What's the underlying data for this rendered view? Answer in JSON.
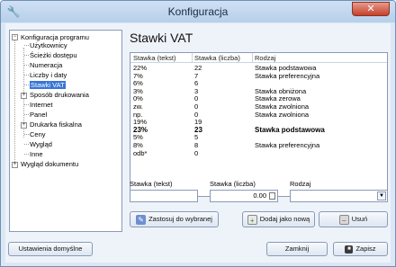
{
  "window": {
    "title": "Konfiguracja",
    "app_icon": "wrench-icon",
    "close": "✕"
  },
  "tree": {
    "root": "Konfiguracja programu",
    "children": [
      "Użytkownicy",
      "Ścieżki dostępu",
      "Numeracja",
      "Liczby i daty",
      "Stawki VAT",
      "Sposób drukowania",
      "Internet",
      "Panel",
      "Drukarka fiskalna",
      "Ceny",
      "Wygląd",
      "Inne"
    ],
    "selected": "Stawki VAT",
    "last": "Wygląd dokumentu"
  },
  "panel_title": "Stawki VAT",
  "table": {
    "headers": [
      "Stawka (tekst)",
      "Stawka (liczba)",
      "Rodzaj"
    ],
    "rows": [
      [
        "22%",
        "22",
        "Stawka podstawowa"
      ],
      [
        "7%",
        "7",
        "Stawka preferencyjna"
      ],
      [
        "6%",
        "6",
        ""
      ],
      [
        "3%",
        "3",
        "Stawka obniżona"
      ],
      [
        "0%",
        "0",
        "Stawka zerowa"
      ],
      [
        "zw.",
        "0",
        "Stawka zwolniona"
      ],
      [
        "np.",
        "0",
        "Stawka zwolniona"
      ],
      [
        "19%",
        "19",
        ""
      ],
      [
        "23%",
        "23",
        "Stawka podstawowa"
      ],
      [
        "5%",
        "5",
        ""
      ],
      [
        "8%",
        "8",
        "Stawka preferencyjna"
      ],
      [
        "odb*",
        "0",
        ""
      ]
    ],
    "bold_row": 8
  },
  "form": {
    "label_text": "Stawka (tekst)",
    "label_num": "Stawka (liczba)",
    "label_kind": "Rodzaj",
    "num_value": "0.00"
  },
  "buttons": {
    "apply": "Zastosuj do wybranej",
    "add": "Dodaj jako nową",
    "delete": "Usuń",
    "defaults": "Ustawienia domyślne",
    "close": "Zamknij",
    "save": "Zapisz"
  }
}
